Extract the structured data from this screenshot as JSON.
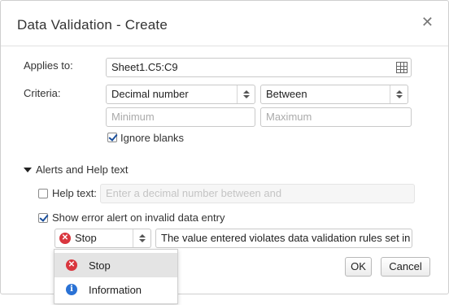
{
  "dialog": {
    "title": "Data Validation - Create",
    "close_glyph": "✕"
  },
  "applies_to": {
    "label": "Applies to:",
    "value": "Sheet1.C5:C9",
    "icon": "range-select-icon"
  },
  "criteria": {
    "label": "Criteria:",
    "type_value": "Decimal number",
    "operator_value": "Between",
    "minimum_placeholder": "Minimum",
    "maximum_placeholder": "Maximum",
    "ignore_blanks_label": "Ignore blanks",
    "ignore_blanks_checked": true
  },
  "alerts": {
    "section_label": "Alerts and Help text",
    "help_text_label": "Help text:",
    "help_text_checked": false,
    "help_text_placeholder": "Enter a decimal number between  and",
    "show_error_label": "Show error alert on invalid data entry",
    "show_error_checked": true,
    "style_value": "Stop",
    "style_icon_glyph": "✕",
    "error_message": "The value entered violates data validation rules set in"
  },
  "dropdown": {
    "items": [
      {
        "label": "Stop",
        "icon": "stop-icon",
        "glyph": "✕",
        "highlighted": true
      },
      {
        "label": "Information",
        "icon": "info-icon",
        "glyph": "i",
        "highlighted": false
      }
    ]
  },
  "buttons": {
    "ok": "OK",
    "cancel": "Cancel"
  }
}
